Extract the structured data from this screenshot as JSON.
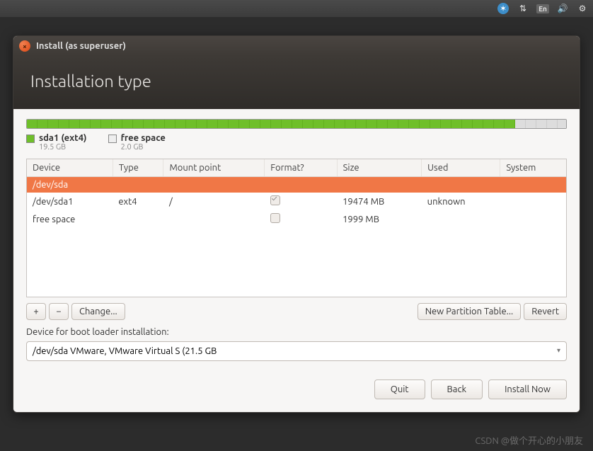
{
  "topbar": {
    "lang": "En"
  },
  "window": {
    "title": "Install (as superuser)"
  },
  "header": {
    "title": "Installation type"
  },
  "diskbar": {
    "segments": [
      {
        "pct": 90.6,
        "cls": "seg-green"
      },
      {
        "pct": 9.4,
        "cls": "seg-gray"
      }
    ]
  },
  "legend": [
    {
      "swatch": "sw-green",
      "label": "sda1 (ext4)",
      "size": "19.5 GB"
    },
    {
      "swatch": "sw-gray",
      "label": "free space",
      "size": "2.0 GB"
    }
  ],
  "table": {
    "headers": [
      "Device",
      "Type",
      "Mount point",
      "Format?",
      "Size",
      "Used",
      "System"
    ],
    "rows": [
      {
        "selected": true,
        "device": "/dev/sda",
        "type": "",
        "mount": "",
        "format": null,
        "size": "",
        "used": "",
        "system": ""
      },
      {
        "selected": false,
        "device": "/dev/sda1",
        "type": "ext4",
        "mount": "/",
        "format": "checked",
        "size": "19474 MB",
        "used": "unknown",
        "system": ""
      },
      {
        "selected": false,
        "device": "free space",
        "type": "",
        "mount": "",
        "format": "unchecked",
        "size": "1999 MB",
        "used": "",
        "system": ""
      }
    ]
  },
  "buttons": {
    "add": "+",
    "remove": "−",
    "change": "Change...",
    "new_table": "New Partition Table...",
    "revert": "Revert",
    "quit": "Quit",
    "back": "Back",
    "install": "Install Now"
  },
  "boot": {
    "label": "Device for boot loader installation:",
    "value": "/dev/sda   VMware, VMware Virtual S (21.5 GB"
  },
  "watermark": "CSDN @做个开心的小朋友"
}
